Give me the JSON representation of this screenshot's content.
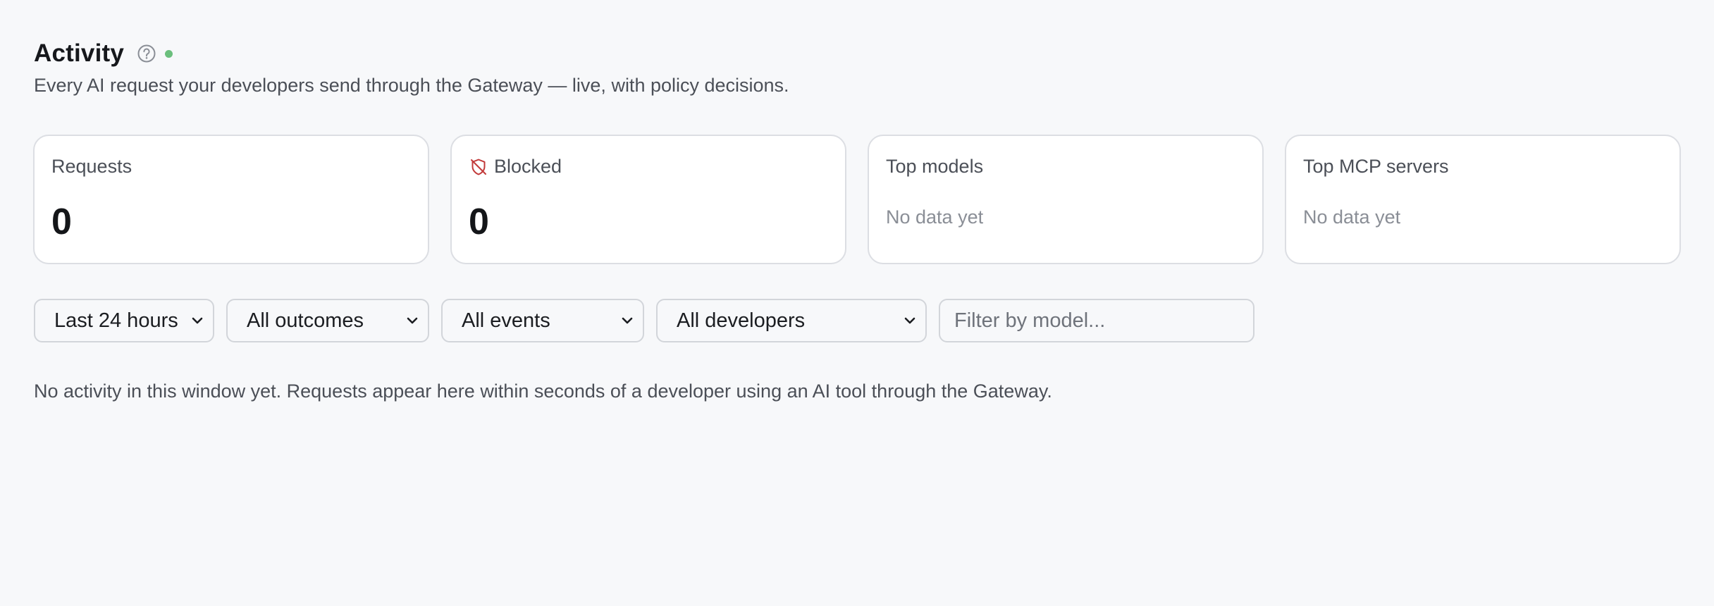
{
  "header": {
    "title": "Activity",
    "subtitle": "Every AI request your developers send through the Gateway — live, with policy decisions.",
    "help_icon": "question-circle-icon",
    "live_indicator_color": "#6bbf7d"
  },
  "cards": {
    "requests": {
      "label": "Requests",
      "value": "0"
    },
    "blocked": {
      "label": "Blocked",
      "value": "0",
      "icon": "shield-off-icon",
      "icon_color": "#c23a3a"
    },
    "top_models": {
      "label": "Top models",
      "empty": "No data yet"
    },
    "top_mcp_servers": {
      "label": "Top MCP servers",
      "empty": "No data yet"
    }
  },
  "filters": {
    "time_range": {
      "selected": "Last 24 hours"
    },
    "outcomes": {
      "selected": "All outcomes"
    },
    "events": {
      "selected": "All events"
    },
    "developers": {
      "selected": "All developers"
    },
    "model": {
      "placeholder": "Filter by model...",
      "value": ""
    }
  },
  "empty_state": "No activity in this window yet. Requests appear here within seconds of a developer using an AI tool through the Gateway."
}
